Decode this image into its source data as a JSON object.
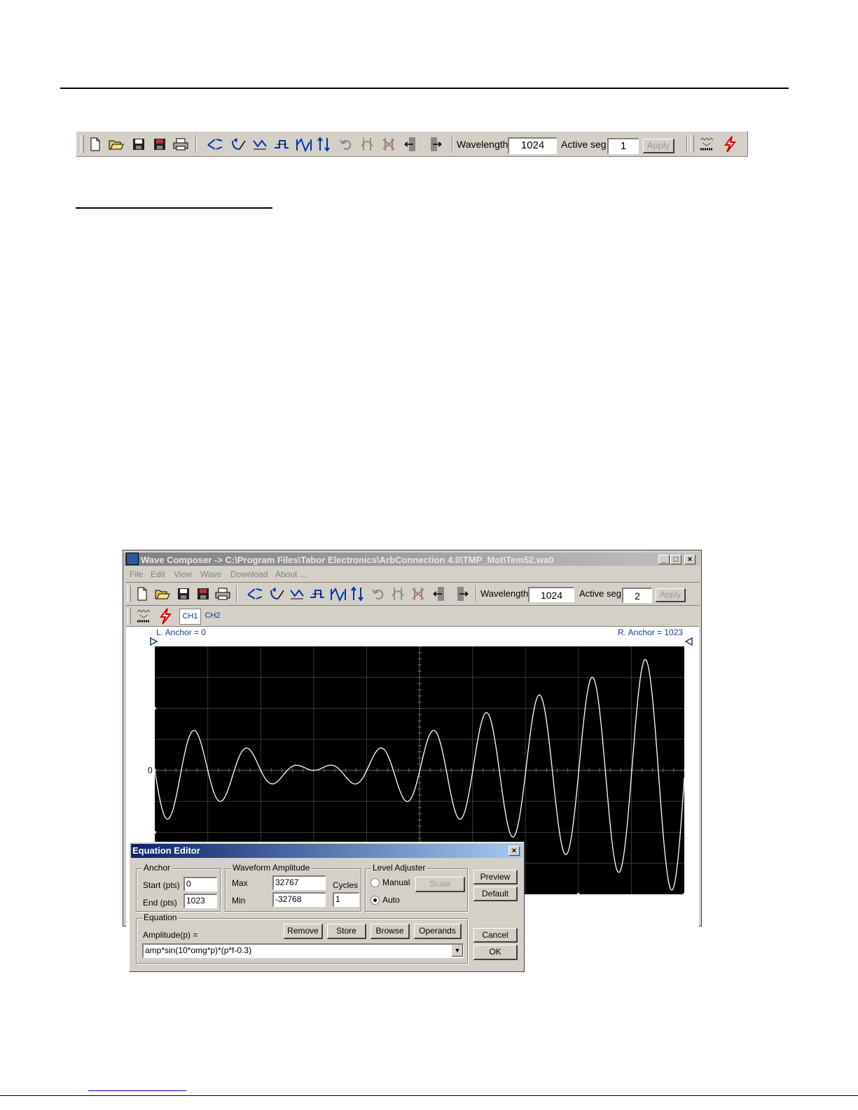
{
  "toolbar": {
    "wavelength_label": "Wavelength",
    "wavelength_value": "1024",
    "active_seg_label": "Active seg",
    "active_seg_value": "1",
    "apply_label": "Apply"
  },
  "window": {
    "title": "Wave Composer -> C:\\Program Files\\Tabor Electronics\\ArbConnection 4.0\\TMP_Mot\\Tem52.wa0",
    "menu": [
      "File",
      "Edit",
      "View",
      "Wave",
      "Download",
      "About ..."
    ],
    "toolbar": {
      "wavelength_label": "Wavelength",
      "wavelength_value": "1024",
      "active_seg_label": "Active seg",
      "active_seg_value": "2",
      "apply_label": "Apply"
    },
    "channel_tabs": [
      "CH1",
      "CH2"
    ],
    "l_anchor": "L. Anchor = 0",
    "r_anchor": "R. Anchor = 1023",
    "zero_label": "0"
  },
  "equation_editor": {
    "title": "Equation Editor",
    "anchor": {
      "group": "Anchor",
      "start_label": "Start (pts)",
      "start_value": "0",
      "end_label": "End  (pts)",
      "end_value": "1023"
    },
    "amplitude": {
      "group": "Waveform Amplitude",
      "max_label": "Max",
      "max_value": "32767",
      "min_label": "Min",
      "min_value": "-32768"
    },
    "cycles": {
      "label": "Cycles",
      "value": "1"
    },
    "level_adjuster": {
      "group": "Level Adjuster",
      "manual_label": "Manual",
      "auto_label": "Auto",
      "scale_label": "Scale"
    },
    "buttons": {
      "preview": "Preview",
      "default": "Default",
      "cancel": "Cancel",
      "ok": "OK",
      "remove": "Remove",
      "store": "Store",
      "browse": "Browse",
      "operands": "Operands"
    },
    "equation": {
      "group": "Equation",
      "amplitude_label": "Amplitude(p) =",
      "expression": "amp*sin(10*omg*p)*(p*f-0.3)"
    }
  },
  "waveform": {
    "points": 1024,
    "sine_cycles": 10,
    "offset": 0.3
  }
}
